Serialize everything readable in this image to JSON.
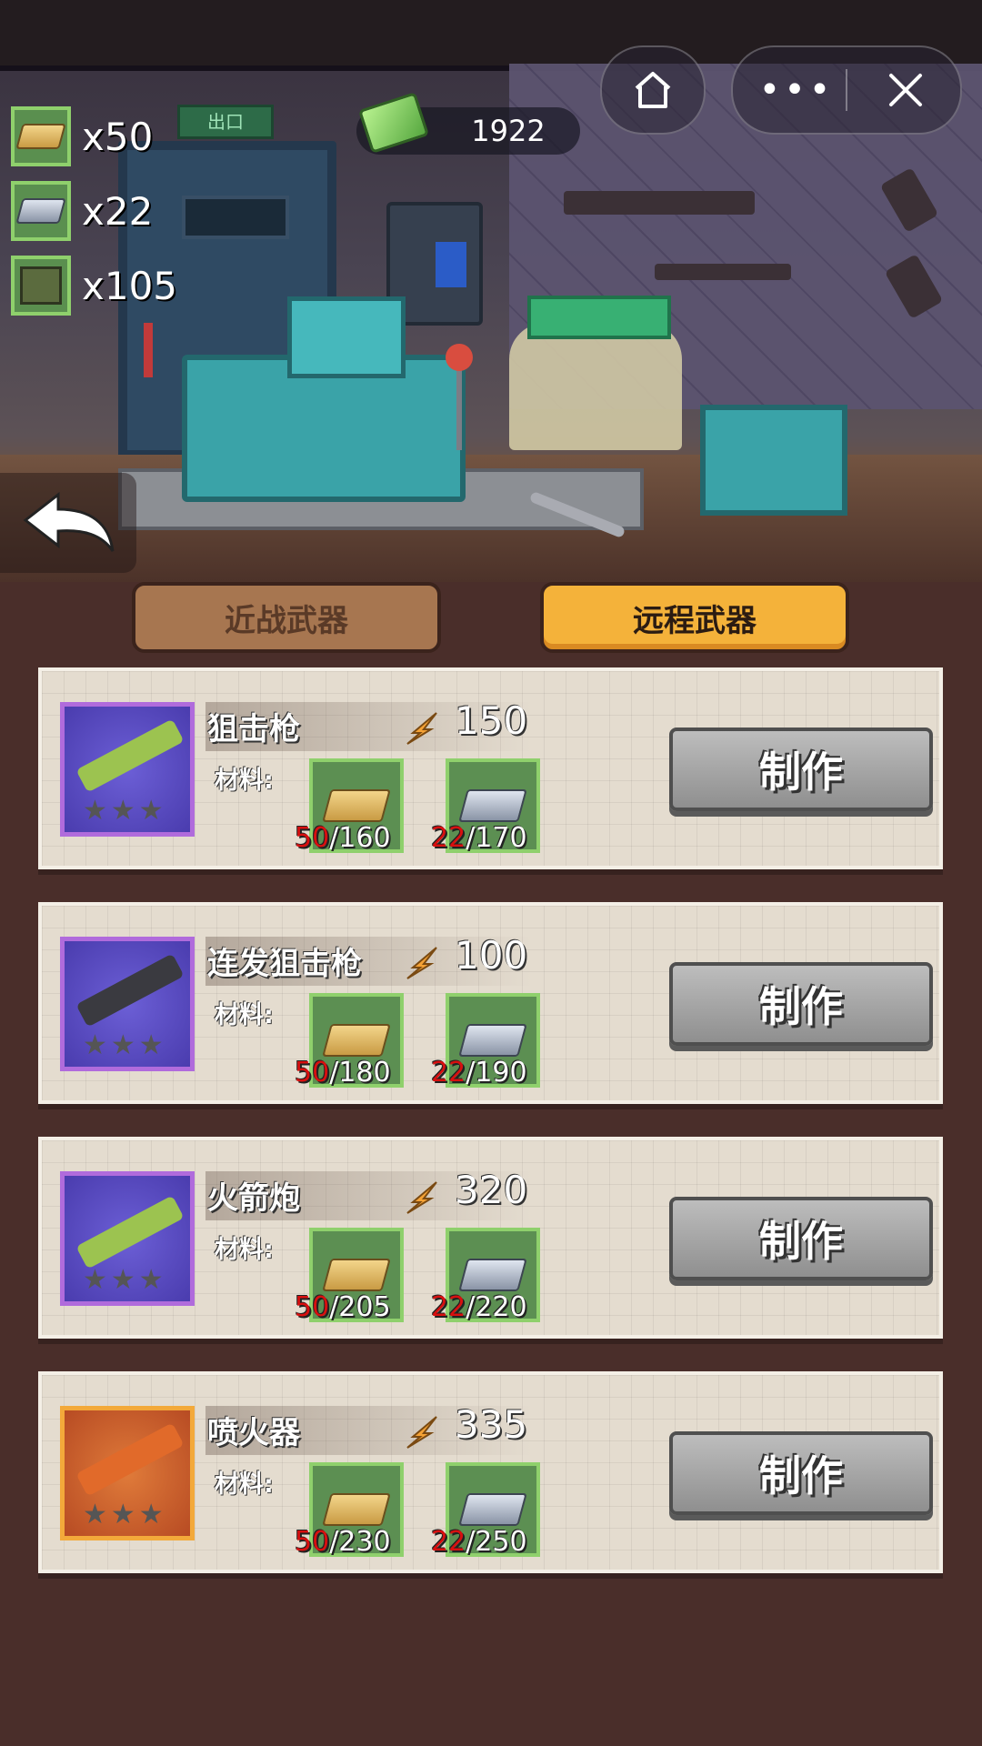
{
  "resources": [
    {
      "icon": "gold-bar-icon",
      "count": "x50"
    },
    {
      "icon": "iron-bar-icon",
      "count": "x22"
    },
    {
      "icon": "supply-crate-icon",
      "count": "x105"
    }
  ],
  "money": {
    "icon": "cash-icon",
    "value": "1922"
  },
  "header": {
    "exit_sign": "出口"
  },
  "tabs": [
    {
      "label": "近战武器",
      "selected": false
    },
    {
      "label": "远程武器",
      "selected": true
    }
  ],
  "items": [
    {
      "name": "狙击枪",
      "power": "150",
      "materials_label": "材料:",
      "gold_have": "50",
      "gold_need": "/160",
      "iron_have": "22",
      "iron_need": "/170",
      "make_label": "制作",
      "rarity_color": "#b06bdc",
      "stars": "★★★"
    },
    {
      "name": "连发狙击枪",
      "power": "100",
      "materials_label": "材料:",
      "gold_have": "50",
      "gold_need": "/180",
      "iron_have": "22",
      "iron_need": "/190",
      "make_label": "制作",
      "rarity_color": "#b06bdc",
      "stars": "★★★"
    },
    {
      "name": "火箭炮",
      "power": "320",
      "materials_label": "材料:",
      "gold_have": "50",
      "gold_need": "/205",
      "iron_have": "22",
      "iron_need": "/220",
      "make_label": "制作",
      "rarity_color": "#b06bdc",
      "stars": "★★★"
    },
    {
      "name": "喷火器",
      "power": "335",
      "materials_label": "材料:",
      "gold_have": "50",
      "gold_need": "/230",
      "iron_have": "22",
      "iron_need": "/250",
      "make_label": "制作",
      "rarity_color": "#f3a93a",
      "stars": "★★★"
    }
  ],
  "colors": {
    "insufficient": "#d80f0f",
    "tab_active": "#f4b23a",
    "tab_inactive": "#a77650",
    "background": "#4a2e2a"
  }
}
